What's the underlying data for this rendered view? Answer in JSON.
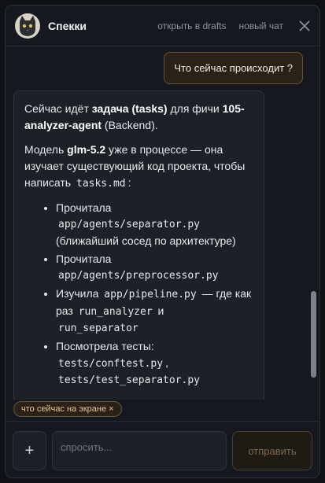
{
  "header": {
    "title": "Спекки",
    "open_drafts": "открыть в drafts",
    "new_chat": "новый чат"
  },
  "messages": {
    "user": "Что сейчас происходит ?",
    "assistant": {
      "p1_a": "Сейчас идёт ",
      "p1_bold1": "задача (tasks)",
      "p1_b": " для фичи ",
      "p1_bold2": "105-analyzer-agent",
      "p1_c": " (Backend).",
      "p2_a": "Модель ",
      "p2_bold": "glm-5.2",
      "p2_b": " уже в процессе — она изучает существующий код проекта, чтобы написать ",
      "p2_code": "tasks.md",
      "p2_c": ":",
      "items": [
        {
          "a": "Прочитала",
          "code": "app/agents/separator.py",
          "b": "(ближайший сосед по архитектуре)"
        },
        {
          "a": "Прочитала",
          "code": "app/agents/preprocessor.py"
        },
        {
          "a": "Изучила",
          "code": "app/pipeline.py",
          "b": "— где как раз",
          "code2": "run_analyzer",
          "c": "и",
          "code3": "run_separator"
        },
        {
          "a": "Посмотрела тесты:",
          "code": "tests/conftest.py",
          "b": ",",
          "code2": "tests/test_separator.py"
        }
      ]
    }
  },
  "context_chip": "что сейчас на экране ×",
  "composer": {
    "plus": "+",
    "placeholder": "спросить...",
    "send": "отправить"
  },
  "colors": {
    "accent": "#e8c48d",
    "background": "#0f1115"
  },
  "icons": {
    "avatar": "cat-avatar-icon",
    "close": "close-icon"
  }
}
